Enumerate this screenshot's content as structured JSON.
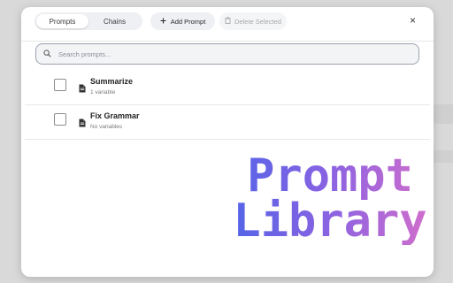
{
  "dialog": {
    "tabs": [
      {
        "label": "Prompts",
        "active": true
      },
      {
        "label": "Chains",
        "active": false
      }
    ],
    "add_button": {
      "label": "Add Prompt",
      "icon": "plus-icon"
    },
    "delete_button": {
      "label": "Delete Selected",
      "icon": "trash-icon",
      "disabled": true
    },
    "close_label": "×",
    "search": {
      "placeholder": "Search prompts...",
      "value": ""
    },
    "prompts": [
      {
        "title": "Summarize",
        "subtitle": "1 variable"
      },
      {
        "title": "Fix Grammar",
        "subtitle": "No variables"
      }
    ]
  },
  "overlay": {
    "line1": "Prompt",
    "line2": "Library",
    "gradient": [
      "#4a64e8",
      "#8a63e2",
      "#e070c8"
    ]
  }
}
